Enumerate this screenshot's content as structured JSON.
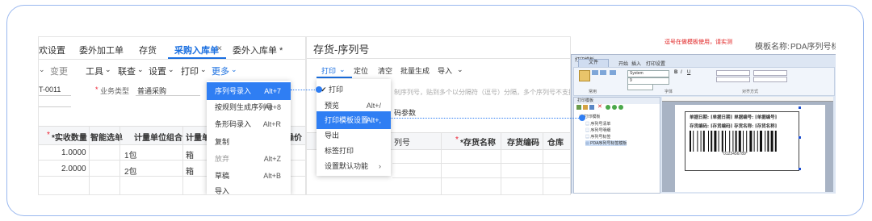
{
  "left_panel": {
    "tabs": [
      "欢设置",
      "委外加工单",
      "存货",
      "采购入库单",
      "委外入库单 *"
    ],
    "active_tab": "采购入库单",
    "toolbar": [
      "变更",
      "工具",
      "联查",
      "设置",
      "打印",
      "更多"
    ],
    "doc_no": "T-0011",
    "biz_type_label": "业务类型",
    "biz_type_value": "普通采购",
    "table_headers": [
      "*实收数量",
      "智能选单",
      "计量单位组合",
      "计量单",
      "操价"
    ],
    "rows": [
      {
        "qty": "1.0000",
        "unit_combo": "1包",
        "unit": "箱"
      },
      {
        "qty": "2.0000",
        "unit_combo": "2包",
        "unit": "箱"
      }
    ],
    "more_menu": [
      {
        "label": "序列号录入",
        "shortcut": "Alt+7",
        "highlight": true
      },
      {
        "label": "按规则生成序列号",
        "shortcut": "Alt+8"
      },
      {
        "label": "条形码录入",
        "shortcut": "Alt+R"
      },
      {
        "label": "复制",
        "shortcut": ""
      },
      {
        "label": "放弃",
        "shortcut": "Alt+Z"
      },
      {
        "label": "草稿",
        "shortcut": "Alt+B"
      },
      {
        "label": "导入",
        "shortcut": ""
      }
    ]
  },
  "middle_panel": {
    "title": "存货-序列号",
    "toolbar": [
      "打印",
      "定位",
      "清空",
      "批量生成",
      "导入"
    ],
    "hint": "制序列号，贴到多个以分隔符（逗号）分隔，多个序列号不支持",
    "param_label": "码参数",
    "table_headers": [
      "列号",
      "*存货名称",
      "存货编码",
      "仓库"
    ],
    "print_menu": [
      {
        "label": "打印",
        "shortcut": "",
        "checked": true
      },
      {
        "label": "预览",
        "shortcut": "Alt+/"
      },
      {
        "label": "打印模板设置",
        "shortcut": "Alt+,",
        "highlight": true
      },
      {
        "label": "导出",
        "shortcut": ""
      },
      {
        "label": "标签打印",
        "shortcut": ""
      },
      {
        "label": "设置默认功能",
        "shortcut": "",
        "arrow": true
      }
    ]
  },
  "right_panel": {
    "warning": "逗号在做模板使用，请实测",
    "template_name_label": "模板名称:",
    "template_name": "PDA序列号标",
    "window_title": "打印模板",
    "ribbon_tabs": [
      "文件",
      "开始",
      "插入",
      "打印设置"
    ],
    "font_name": "System",
    "font_size": "9",
    "align_group": "对齐方式",
    "ribbon_groups": [
      "常用",
      "字体",
      "对齐方式"
    ],
    "tree_root": "打印模板",
    "tree_items": [
      "序列号清单",
      "序列号明细",
      "序列号标签",
      "PDA序列号标签模板"
    ],
    "label_line1": "单据日期: [单据日期]   单据编号: [单据编号]",
    "label_line2": "存货编码: [存货编码]   存货名称: [存货名称]",
    "barcode_text": "*0123456789*"
  }
}
